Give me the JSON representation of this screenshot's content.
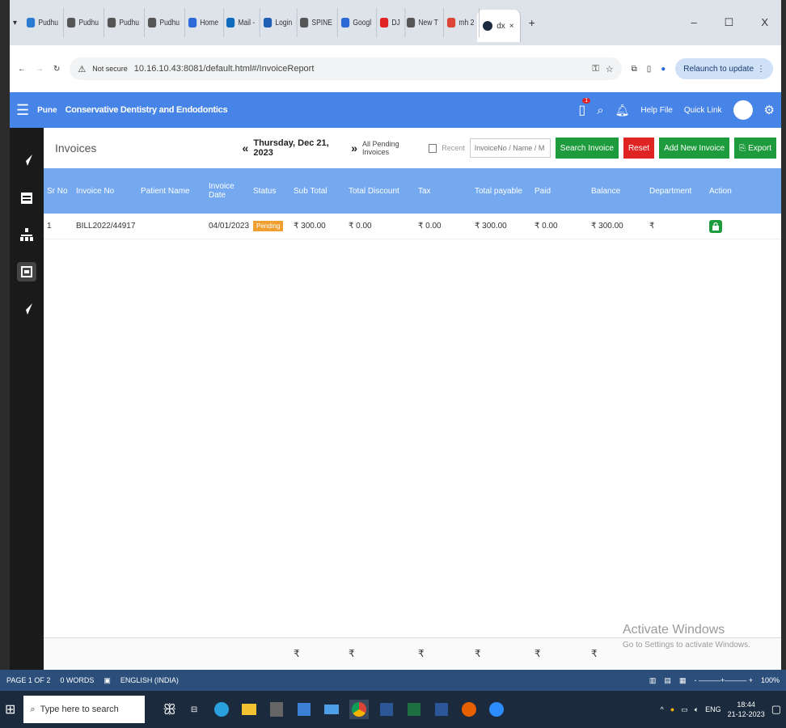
{
  "browser": {
    "tabs": [
      {
        "label": "Pudhu",
        "color": "#2b7bd1"
      },
      {
        "label": "Pudhu",
        "color": "#555"
      },
      {
        "label": "Pudhu",
        "color": "#555"
      },
      {
        "label": "Pudhu",
        "color": "#555"
      },
      {
        "label": "Home",
        "color": "#2e6bd8"
      },
      {
        "label": "Mail -",
        "color": "#0f6cbd"
      },
      {
        "label": "Login",
        "color": "#1e5fb3"
      },
      {
        "label": "SPINE",
        "color": "#555"
      },
      {
        "label": "Googl",
        "color": "#2a6ad6"
      },
      {
        "label": "DJ",
        "color": "#e02424"
      },
      {
        "label": "New T",
        "color": "#555"
      },
      {
        "label": "mh 2",
        "color": "#db4437"
      }
    ],
    "active_tab": "dx",
    "new_tab": "+",
    "minimize": "–",
    "maximize": "☐",
    "close": "X",
    "security": "Not secure",
    "url": "10.16.10.43:8081/default.html#/InvoiceReport",
    "relaunch": "Relaunch to update"
  },
  "appbar": {
    "location": "Pune",
    "clinic": "Conservative Dentistry and Endodontics",
    "badge": "1",
    "help": "Help File",
    "quick": "Quick Link"
  },
  "page": {
    "title": "Invoices",
    "date": "Thursday, Dec 21, 2023",
    "prev": "«",
    "next": "»",
    "all_pending": "All Pending Invoices",
    "recent": "Recent",
    "search_placeholder": "InvoiceNo / Name / M",
    "search_btn": "Search Invoice",
    "reset_btn": "Reset",
    "add_btn": "Add New Invoice",
    "export_btn": "Export"
  },
  "table": {
    "headers": [
      "Sr No",
      "Invoice No",
      "Patient Name",
      "Invoice Date",
      "Status",
      "Sub Total",
      "Total Discount",
      "Tax",
      "Total payable",
      "Paid",
      "Balance",
      "Department",
      "Action"
    ],
    "rows": [
      {
        "sr": "1",
        "invoice": "BILL2022/44917",
        "patient": "",
        "date": "04/01/2023",
        "status": "Pending",
        "subtotal": "₹ 300.00",
        "discount": "₹ 0.00",
        "tax": "₹ 0.00",
        "payable": "₹ 300.00",
        "paid": "₹ 0.00",
        "balance": "₹ 300.00",
        "department": "₹"
      }
    ],
    "footer": [
      "",
      "",
      "",
      "",
      "",
      "₹",
      "₹",
      "₹",
      "₹",
      "₹",
      "₹",
      "",
      ""
    ]
  },
  "watermark": {
    "line1": "Activate Windows",
    "line2": "Go to Settings to activate Windows."
  },
  "word": {
    "page": "PAGE 1 OF 2",
    "words": "0 WORDS",
    "lang": "ENGLISH (INDIA)",
    "zoom": "100%"
  },
  "taskbar": {
    "search": "Type here to search",
    "lang": "ENG",
    "time": "18:44",
    "date": "21-12-2023"
  }
}
